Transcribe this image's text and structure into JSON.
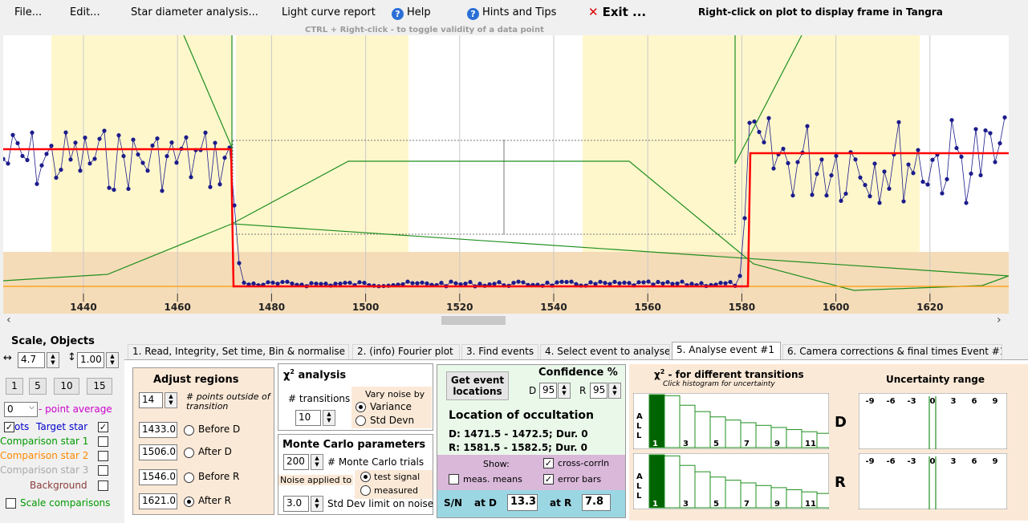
{
  "menu": {
    "file": "File...",
    "edit": "Edit...",
    "star_diameter": "Star diameter analysis...",
    "light_curve": "Light curve report",
    "help": "Help",
    "hints": "Hints and Tips",
    "exit": "Exit ...",
    "right_click_hint": "Right-click on plot to display frame in Tangra",
    "ctrl_hint": "CTRL + Right-click  -  to toggle validity of a data point"
  },
  "plot": {
    "x_ticks": [
      "1440",
      "1460",
      "1480",
      "1500",
      "1520",
      "1540",
      "1560",
      "1580",
      "1600",
      "1620"
    ],
    "colors": {
      "lightcurve": "#1c1c8c",
      "model": "#ff0000",
      "chi": "#1f8f1f",
      "baseline": "#ff9900",
      "region": "#fff7cc",
      "band": "#f5dcb8"
    }
  },
  "scale": {
    "title": "Scale,  Objects",
    "h_scale": "4.7",
    "v_scale": "1.00",
    "buttons": [
      "1",
      "5",
      "10",
      "15"
    ],
    "point_avg_value": "0",
    "point_avg_label": "- point average",
    "objects": [
      {
        "label": "Target star",
        "prefix": "ots",
        "checked": true,
        "color": "#0000cc"
      },
      {
        "label": "Comparison star 1",
        "checked": false,
        "color": "#009900"
      },
      {
        "label": "Comparison star 2",
        "checked": false,
        "color": "#ff8800"
      },
      {
        "label": "Comparison star 3",
        "checked": false,
        "color": "#aaaaaa"
      },
      {
        "label": "Background",
        "checked": false,
        "color": "#8b3a3a"
      }
    ],
    "scale_comparisons": "Scale comparisons"
  },
  "tabs": [
    "1.  Read, Integrity, Set time, Bin & normalise",
    "2. (info)  Fourier plot",
    "3. Find events",
    "4. Select event to analyse",
    "5. Analyse event #1",
    "6. Camera corrections & final times Event #1"
  ],
  "adjust": {
    "title": "Adjust regions",
    "points_value": "14",
    "points_label": "# points outside of transition",
    "regions": [
      {
        "value": "1433.0",
        "label": "Before D",
        "selected": false
      },
      {
        "value": "1506.0",
        "label": "After D",
        "selected": false
      },
      {
        "value": "1546.0",
        "label": "Before R",
        "selected": false
      },
      {
        "value": "1621.0",
        "label": "After R",
        "selected": true
      }
    ]
  },
  "chi": {
    "title": "χ",
    "title_rest": " analysis",
    "transitions_label": "# transitions",
    "transitions_value": "10",
    "vary_label": "Vary noise by",
    "variance": "Variance",
    "stddev": "Std Devn"
  },
  "monte": {
    "title": "Monte Carlo parameters",
    "trials_value": "200",
    "trials_label": "# Monte Carlo trials",
    "noise_label": "Noise applied to",
    "test_signal": "test signal",
    "measured": "measured",
    "limit_value": "3.0",
    "limit_label": "Std Dev limit on noise"
  },
  "event": {
    "get_button": "Get event locations",
    "confidence_title": "Confidence %",
    "d_label": "D",
    "d_value": "95",
    "r_label": "R",
    "r_value": "95",
    "location_title": "Location of occultation",
    "d_line": "D: 1471.5 - 1472.5; Dur. 0",
    "r_line": "R: 1581.5 - 1582.5; Dur. 0",
    "show_label": "Show:",
    "cross_corr": "cross-corrln",
    "meas_means": "meas. means",
    "error_bars": "error bars",
    "sn_label": "S/N",
    "at_d": "at D",
    "at_d_value": "13.3",
    "at_r": "at R",
    "at_r_value": "7.8"
  },
  "histo": {
    "title": "χ",
    "title_rest": " -  for different transitions",
    "subtitle": "Click histogram for uncertainty",
    "side_label": [
      "A",
      "L",
      "L"
    ],
    "x_labels": [
      "1",
      "3",
      "5",
      "7",
      "9",
      "11"
    ],
    "d_label": "D",
    "r_label": "R",
    "bars": [
      1.0,
      0.98,
      0.8,
      0.68,
      0.58,
      0.52,
      0.47,
      0.42,
      0.38,
      0.34,
      0.3,
      0.27
    ]
  },
  "uncertainty": {
    "title": "Uncertainty range",
    "ticks": [
      "-9",
      "-6",
      "-3",
      "0",
      "3",
      "6",
      "9"
    ]
  }
}
